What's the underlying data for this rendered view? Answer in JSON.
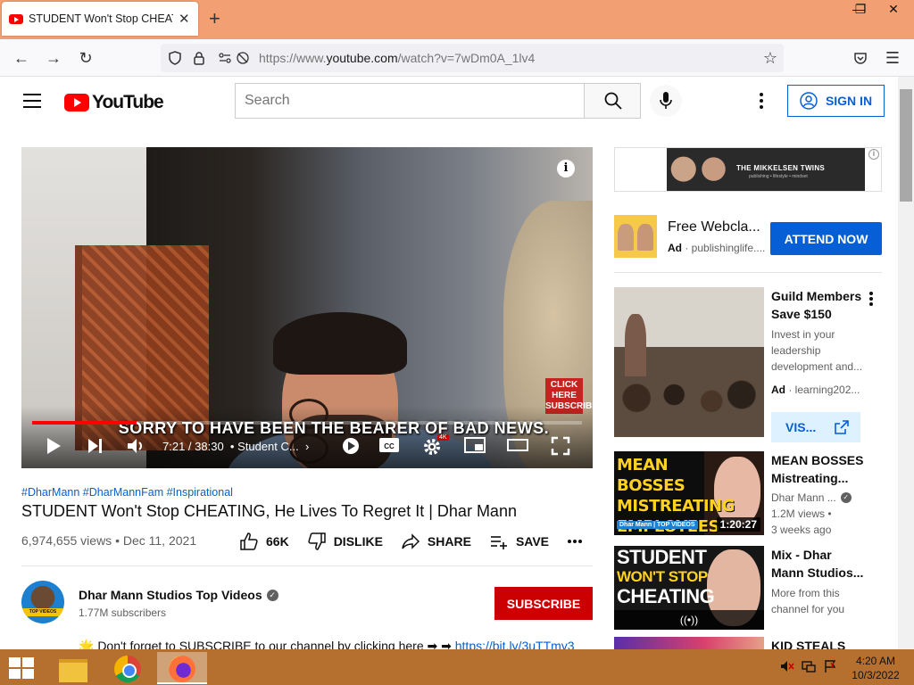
{
  "browser": {
    "tab_title": "STUDENT Won't Stop CHEATING, He Lives To Regret It | Dhar Mann",
    "tab_close": "✕",
    "new_tab": "+",
    "url_prefix": "https://www.",
    "url_domain": "youtube.com",
    "url_path": "/watch?v=7wDm0A_1lv4",
    "window_controls": {
      "minimize": "—",
      "restore": "❐",
      "close": "✕"
    }
  },
  "masthead": {
    "logo_text": "YouTube",
    "search_placeholder": "Search",
    "signin_label": "SIGN IN"
  },
  "player": {
    "subtitle": "SORRY TO HAVE BEEN THE BEARER OF BAD NEWS.",
    "click_here": "CLICK HERE SUBSCRIBE",
    "info_icon": "i",
    "time": "7:21 / 38:30",
    "chapter": "• Student C...",
    "progress_fraction": 0.19,
    "quality_badge": "4K"
  },
  "video": {
    "hashtags": "#DharMann #DharMannFam #Inspirational",
    "title": "STUDENT Won't Stop CHEATING, He Lives To Regret It | Dhar Mann",
    "stats": "6,974,655 views • Dec 11, 2021",
    "actions": {
      "like": "66K",
      "dislike": "DISLIKE",
      "share": "SHARE",
      "save": "SAVE"
    }
  },
  "channel": {
    "name": "Dhar Mann Studios Top Videos",
    "subscribers": "1.77M subscribers",
    "subscribe_label": "SUBSCRIBE",
    "avatar_band": "TOP VIDEOS",
    "description": "🌟 Don't forget to SUBSCRIBE to our channel by clicking here ➡ ➡ ",
    "description_link": "https://bit.ly/3uTTmy3"
  },
  "sidebar": {
    "banner": {
      "title": "THE MIKKELSEN TWINS",
      "sub": "publishing • lifestyle • mindset"
    },
    "ad": {
      "title": "Free Webcla...",
      "ad_label": "Ad",
      "source": "· publishinglife....",
      "button": "ATTEND NOW"
    },
    "promoted": {
      "title_1": "Guild Members",
      "title_2": "Save $150",
      "desc_1": "Invest in your",
      "desc_2": "leadership",
      "desc_3": "development and...",
      "ad_label": "Ad",
      "source": "· learning202...",
      "visit_label": "VIS..."
    },
    "videos": [
      {
        "thumb_text": "MEAN BOSSES MISTREATING EMPLOYEES",
        "thumb_brand": "Dhar Mann | TOP VIDEOS",
        "duration": "1:20:27",
        "title_1": "MEAN BOSSES",
        "title_2": "Mistreating...",
        "channel": "Dhar Mann ...",
        "views": "1.2M views •",
        "age": "3 weeks ago"
      },
      {
        "thumb_text_1": "STUDENT",
        "thumb_text_2": "WON'T STOP",
        "thumb_text_3": "CHEATING",
        "live_icon": "((•))",
        "title_1": "Mix - Dhar",
        "title_2": "Mann Studios...",
        "desc_1": "More from this",
        "desc_2": "channel for you"
      },
      {
        "title_1": "KID STEALS"
      }
    ]
  },
  "taskbar": {
    "time": "4:20 AM",
    "date": "10/3/2022"
  },
  "colors": {
    "title_bar": "#f29f73",
    "youtube_red": "#ff0000",
    "link_blue": "#065fd4",
    "subscribe_red": "#cc0000",
    "taskbar": "#b5702f"
  }
}
